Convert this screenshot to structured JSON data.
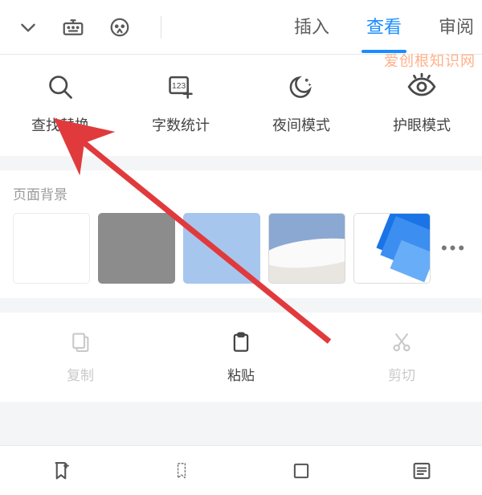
{
  "topbar": {
    "tabs": [
      {
        "label": "插入",
        "active": false
      },
      {
        "label": "查看",
        "active": true
      },
      {
        "label": "审阅",
        "active": false
      }
    ]
  },
  "tools": [
    {
      "label": "查找替换",
      "icon": "search-icon"
    },
    {
      "label": "字数统计",
      "icon": "word-count-icon"
    },
    {
      "label": "夜间模式",
      "icon": "night-mode-icon"
    },
    {
      "label": "护眼模式",
      "icon": "eye-care-icon"
    }
  ],
  "background_section": {
    "title": "页面背景",
    "swatches": [
      {
        "name": "white",
        "color": "#ffffff"
      },
      {
        "name": "gray",
        "color": "#8c8c8c"
      },
      {
        "name": "blue-light",
        "color": "#a7c6ee"
      },
      {
        "name": "pattern-clouds",
        "color": "#8aa8d2"
      },
      {
        "name": "pattern-blue-geom",
        "color": "#1a74e6"
      }
    ],
    "more_label": "•••"
  },
  "edit_actions": [
    {
      "label": "复制",
      "icon": "copy-icon",
      "enabled": false
    },
    {
      "label": "粘贴",
      "icon": "paste-icon",
      "enabled": true
    },
    {
      "label": "剪切",
      "icon": "cut-icon",
      "enabled": false
    }
  ],
  "bottombar": {
    "items": [
      {
        "icon": "bookmark-add-icon"
      },
      {
        "icon": "bookmark-icon"
      },
      {
        "icon": "rectangle-icon"
      },
      {
        "icon": "list-icon"
      }
    ]
  },
  "annotation": {
    "arrow_color": "#e13a3c"
  },
  "watermark": "爱创根知识网"
}
